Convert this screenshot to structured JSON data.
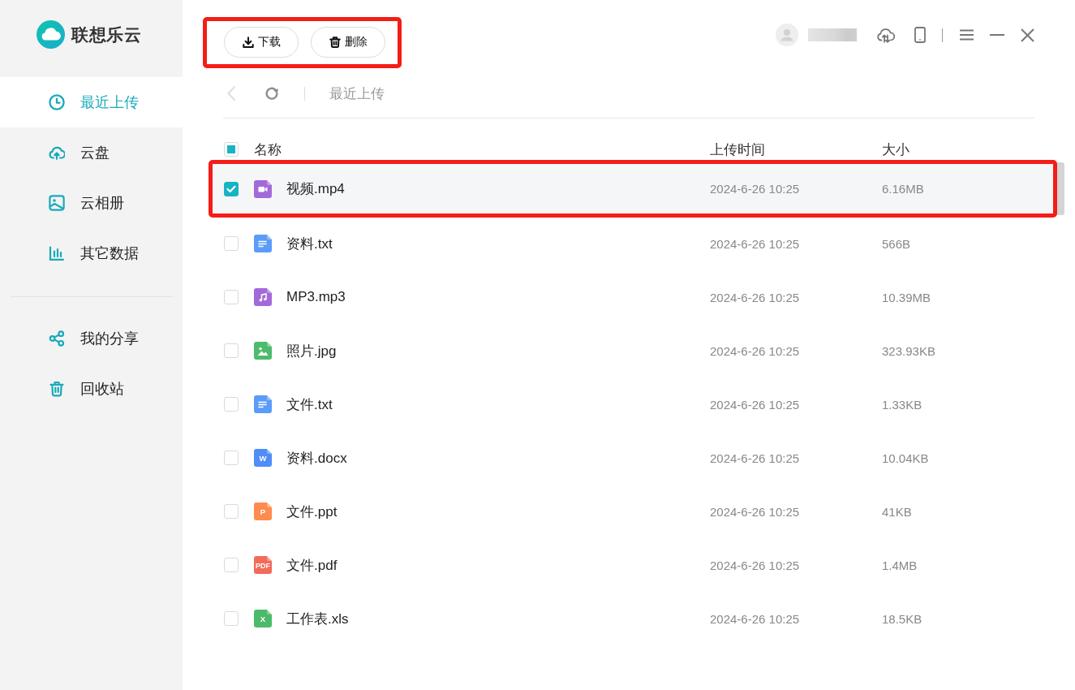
{
  "app": {
    "logo_text": "联想乐云"
  },
  "sidebar": {
    "items": [
      {
        "label": "最近上传",
        "kind": "recent",
        "selected": true
      },
      {
        "label": "云盘",
        "kind": "drive",
        "selected": false
      },
      {
        "label": "云相册",
        "kind": "album",
        "selected": false
      },
      {
        "label": "其它数据",
        "kind": "other",
        "selected": false
      }
    ],
    "secondary_items": [
      {
        "label": "我的分享",
        "kind": "share",
        "selected": false
      },
      {
        "label": "回收站",
        "kind": "recycle",
        "selected": false
      }
    ]
  },
  "toolbar": {
    "highlighted": true,
    "buttons": [
      {
        "label": "下载",
        "kind": "download"
      },
      {
        "label": "删除",
        "kind": "delete"
      }
    ]
  },
  "breadcrumb": {
    "back_disabled": true,
    "path": "最近上传"
  },
  "table": {
    "select_all": {
      "checked": false,
      "indeterminate": true
    },
    "columns": [
      "名称",
      "上传时间",
      "大小"
    ],
    "rows": [
      {
        "name": "视频.mp4",
        "uploaded": "2024-6-26 10:25",
        "size": "6.16MB",
        "kind": "video",
        "selected": true,
        "highlighted": true
      },
      {
        "name": "资料.txt",
        "uploaded": "2024-6-26 10:25",
        "size": "566B",
        "kind": "text",
        "selected": false,
        "highlighted": false
      },
      {
        "name": "MP3.mp3",
        "uploaded": "2024-6-26 10:25",
        "size": "10.39MB",
        "kind": "audio",
        "selected": false,
        "highlighted": false
      },
      {
        "name": "照片.jpg",
        "uploaded": "2024-6-26 10:25",
        "size": "323.93KB",
        "kind": "image",
        "selected": false,
        "highlighted": false
      },
      {
        "name": "文件.txt",
        "uploaded": "2024-6-26 10:25",
        "size": "1.33KB",
        "kind": "text",
        "selected": false,
        "highlighted": false
      },
      {
        "name": "资料.docx",
        "uploaded": "2024-6-26 10:25",
        "size": "10.04KB",
        "kind": "word",
        "badge": "W",
        "selected": false,
        "highlighted": false
      },
      {
        "name": "文件.ppt",
        "uploaded": "2024-6-26 10:25",
        "size": "41KB",
        "kind": "ppt",
        "badge": "P",
        "selected": false,
        "highlighted": false
      },
      {
        "name": "文件.pdf",
        "uploaded": "2024-6-26 10:25",
        "size": "1.4MB",
        "kind": "pdf",
        "badge": "PDF",
        "selected": false,
        "highlighted": false
      },
      {
        "name": "工作表.xls",
        "uploaded": "2024-6-26 10:25",
        "size": "18.5KB",
        "kind": "excel",
        "badge": "X",
        "selected": false,
        "highlighted": false
      }
    ]
  }
}
